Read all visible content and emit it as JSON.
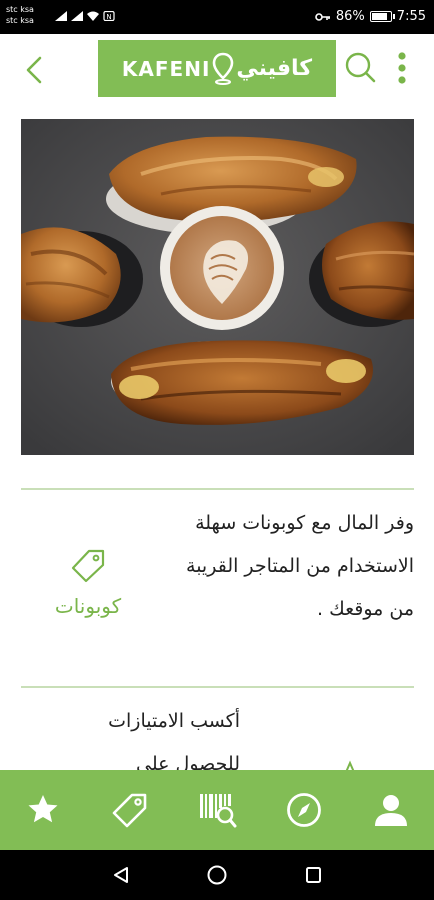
{
  "status_bar": {
    "carrier_1": "stc ksa",
    "carrier_2": "stc ksa",
    "battery_text": "86%",
    "battery_level": 0.86,
    "time": "7:55"
  },
  "header": {
    "logo_latin": "KAFENI",
    "logo_arabic": "كافيني",
    "icons": [
      "chevron-left-icon",
      "map-pin-icon",
      "search-icon",
      "more-vertical-icon"
    ]
  },
  "features": [
    {
      "text": "وفر المال مع كوبونات سهلة الاستخدام من المتاجر القريبة من موقعك .",
      "label": "كوبونات",
      "icon": "tag-icon"
    },
    {
      "text": "أكسب الامتيازات للحصول على",
      "label": "",
      "icon": "star-icon"
    }
  ],
  "bottom_nav": [
    {
      "icon": "star-icon"
    },
    {
      "icon": "tag-icon"
    },
    {
      "icon": "barcode-search-icon"
    },
    {
      "icon": "compass-icon"
    },
    {
      "icon": "user-icon"
    }
  ],
  "colors": {
    "brand_green": "#82bd55",
    "label_green": "#7ab54a",
    "divider": "#c9dfb8"
  }
}
